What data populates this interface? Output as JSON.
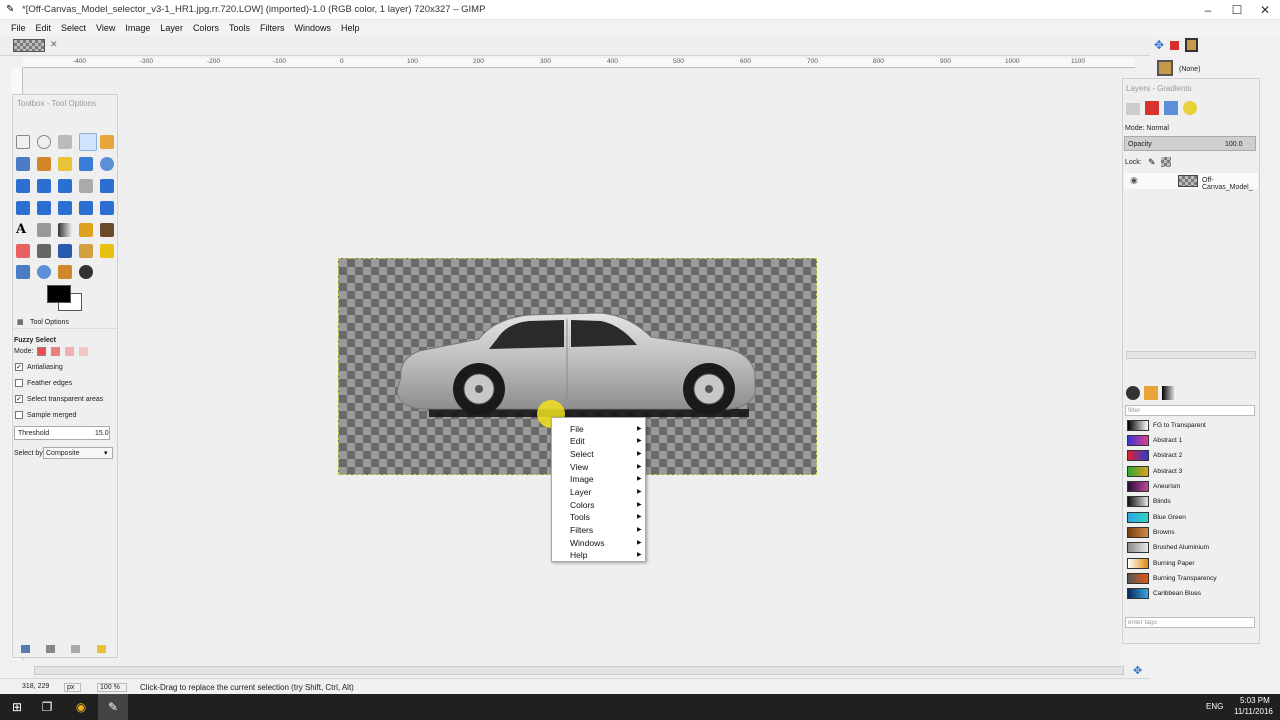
{
  "window": {
    "title": "*[Off-Canvas_Model_selector_v3-1_HR1.jpg.rr.720.LOW] (imported)-1.0 (RGB color, 1 layer) 720x327 – GIMP",
    "minimize": "–",
    "maximize": "☐",
    "close": "✕"
  },
  "menubar": [
    "File",
    "Edit",
    "Select",
    "View",
    "Image",
    "Layer",
    "Colors",
    "Tools",
    "Filters",
    "Windows",
    "Help"
  ],
  "ruler_top": [
    "-400",
    "-300",
    "-200",
    "-100",
    "0",
    "100",
    "200",
    "300",
    "400",
    "500",
    "600",
    "700",
    "800",
    "900",
    "1000",
    "1100"
  ],
  "toolbox": {
    "title": "Toolbox - Tool Options",
    "tab_label": "Tool Options",
    "tool_name": "Fuzzy Select",
    "mode_label": "Mode:",
    "antialiasing": {
      "label": "Antialiasing",
      "checked": true
    },
    "feather": {
      "label": "Feather edges",
      "checked": false
    },
    "select_transparent": {
      "label": "Select transparent areas",
      "checked": true
    },
    "sample_merged": {
      "label": "Sample merged",
      "checked": false
    },
    "threshold": {
      "label": "Threshold",
      "value": "15.0"
    },
    "select_by": {
      "label": "Select by:",
      "value": "Composite"
    }
  },
  "context_menu": [
    "File",
    "Edit",
    "Select",
    "View",
    "Image",
    "Layer",
    "Colors",
    "Tools",
    "Filters",
    "Windows",
    "Help"
  ],
  "dock": {
    "none_label": "(None)",
    "layers_title": "Layers - Gradients",
    "mode": "Mode: Normal",
    "opacity_label": "Opacity",
    "opacity_value": "100.0",
    "lock_label": "Lock:",
    "layer_name": "Off-Canvas_Model_",
    "filter_placeholder": "filter",
    "tags_placeholder": "enter tags",
    "gradients": [
      {
        "name": "FG to Transparent",
        "c1": "#000000",
        "c2": "#ffffff"
      },
      {
        "name": "Abstract 1",
        "c1": "#3a36d8",
        "c2": "#e23e8a"
      },
      {
        "name": "Abstract 2",
        "c1": "#e5212b",
        "c2": "#2a3ad6"
      },
      {
        "name": "Abstract 3",
        "c1": "#2ca82e",
        "c2": "#e3a21f"
      },
      {
        "name": "Aneurism",
        "c1": "#2a0c3a",
        "c2": "#c24a9a"
      },
      {
        "name": "Blinds",
        "c1": "#111111",
        "c2": "#e5e5e5"
      },
      {
        "name": "Blue Green",
        "c1": "#27a6e5",
        "c2": "#30d8c2"
      },
      {
        "name": "Browns",
        "c1": "#7a3f12",
        "c2": "#d28a44"
      },
      {
        "name": "Brushed Aluminium",
        "c1": "#8a8a8a",
        "c2": "#e8e8e8"
      },
      {
        "name": "Burning Paper",
        "c1": "#ffffff",
        "c2": "#e08a12"
      },
      {
        "name": "Burning Transparency",
        "c1": "#555555",
        "c2": "#e05a12"
      },
      {
        "name": "Caribbean Blues",
        "c1": "#062a5a",
        "c2": "#3ba6e0"
      }
    ]
  },
  "status": {
    "coords": "318, 229",
    "unit": "px",
    "zoom": "100 %",
    "message": "Click-Drag to replace the current selection (try Shift, Ctrl, Alt)"
  },
  "taskbar": {
    "time": "5:03 PM",
    "date": "11/11/2016",
    "lang": "ENG"
  },
  "colors": {
    "accent": "#3a7bd5",
    "checker_dark": "#6a6a6a",
    "checker_light": "#9a9a9a"
  }
}
